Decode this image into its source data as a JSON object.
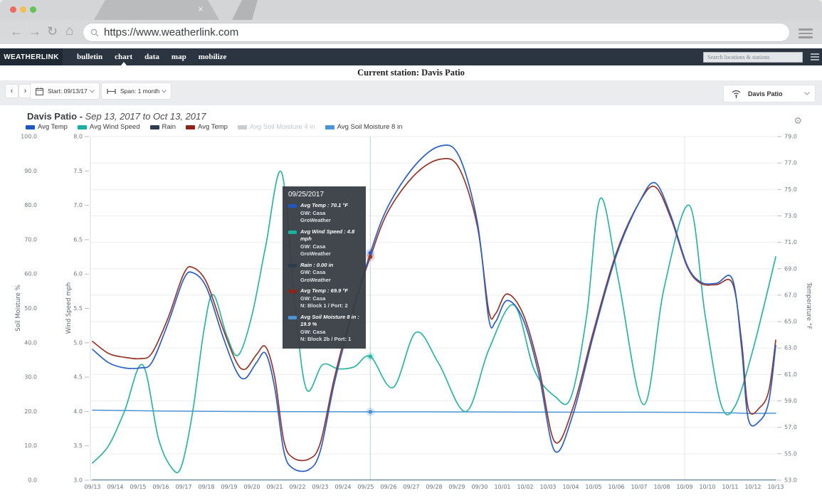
{
  "browser": {
    "url": "https://www.weatherlink.com",
    "tab_close_label": "×"
  },
  "nav": {
    "brand": "WEATHERLINK",
    "items": [
      {
        "label": "bulletin",
        "active": false
      },
      {
        "label": "chart",
        "active": true
      },
      {
        "label": "data",
        "active": false
      },
      {
        "label": "map",
        "active": false
      },
      {
        "label": "mobilize",
        "active": false
      }
    ],
    "search_placeholder": "Search locations & stations"
  },
  "station_bar": {
    "label": "Current station: Davis Patio"
  },
  "controls": {
    "prev": "‹",
    "next": "›",
    "start_label": "Start: 09/13/17",
    "span_label": "Span: 1 month",
    "station_name": "Davis Patio"
  },
  "chart": {
    "title_bold": "Davis Patio - ",
    "title_range": "Sep 13, 2017 to Oct 13, 2017"
  },
  "legend": {
    "items": [
      {
        "label": "Avg Temp",
        "color": "#1f57c0",
        "disabled": false
      },
      {
        "label": "Avg Wind Speed",
        "color": "#18b0a0",
        "disabled": false
      },
      {
        "label": "Rain",
        "color": "#2d3c4e",
        "disabled": false
      },
      {
        "label": "Avg Temp",
        "color": "#8e2318",
        "disabled": false
      },
      {
        "label": "Avg Soil Moisture 4 in",
        "color": "#c7cdd3",
        "disabled": true
      },
      {
        "label": "Avg Soil Moisture 8 in",
        "color": "#4a93d4",
        "disabled": false
      }
    ]
  },
  "tooltip": {
    "date": "09/25/2017",
    "entries": [
      {
        "color": "#1f57c0",
        "value_line": "Avg Temp : 70.1 °F",
        "gw_line": "GW: Casa",
        "src_line": "GroWeather"
      },
      {
        "color": "#18b0a0",
        "value_line": "Avg Wind Speed : 4.8 mph",
        "gw_line": "GW: Casa",
        "src_line": "GroWeather"
      },
      {
        "color": "#2d3c4e",
        "value_line": "Rain : 0.00 in",
        "gw_line": "GW: Casa",
        "src_line": "GroWeather"
      },
      {
        "color": "#8e2318",
        "value_line": "Avg Temp : 69.9 °F",
        "gw_line": "GW: Casa",
        "src_line": "N: Block 1 / Port: 2"
      },
      {
        "color": "#4a93d4",
        "value_line": "Avg Soil Moisture 8 in : 19.9 %",
        "gw_line": "GW: Casa",
        "src_line": "N: Block 2b / Port: 1"
      }
    ]
  },
  "chart_data": {
    "type": "line",
    "title": "Davis Patio - Sep 13, 2017 to Oct 13, 2017",
    "x_labels": [
      "09/13",
      "09/14",
      "09/15",
      "09/16",
      "09/17",
      "09/18",
      "09/19",
      "09/20",
      "09/21",
      "09/22",
      "09/23",
      "09/24",
      "09/25",
      "09/26",
      "09/27",
      "09/28",
      "09/29",
      "09/30",
      "10/01",
      "10/02",
      "10/03",
      "10/04",
      "10/05",
      "10/06",
      "10/07",
      "10/08",
      "10/09",
      "10/10",
      "10/11",
      "10/12",
      "10/13"
    ],
    "axes": {
      "soil": {
        "title": "Soil Moisture %",
        "min": 0,
        "max": 100,
        "ticks": [
          "100.0",
          "90.0",
          "80.0",
          "70.0",
          "60.0",
          "50.0",
          "40.0",
          "30.0",
          "20.0",
          "10.0",
          "0.0"
        ]
      },
      "wind": {
        "title": "Wind Speed mph",
        "min": 3,
        "max": 8,
        "ticks": [
          "8.0",
          "7.5",
          "7.0",
          "6.5",
          "6.0",
          "5.5",
          "5.0",
          "4.5",
          "4.0",
          "3.5",
          "3.0"
        ]
      },
      "temp": {
        "title": "Temperature °F",
        "min": 53,
        "max": 79,
        "ticks": [
          "79.0",
          "77.0",
          "75.0",
          "73.0",
          "71.0",
          "69.0",
          "67.0",
          "65.0",
          "63.0",
          "61.0",
          "59.0",
          "57.0",
          "55.0",
          "53.0"
        ]
      }
    },
    "crosshair": {
      "day": 12.2,
      "date": "09/25/2017"
    },
    "highlight_vline_day": 26,
    "series": [
      {
        "name": "Avg Temp",
        "unit": "°F",
        "axis": "temp",
        "color": "#2b5fc4",
        "width": 1.7,
        "points": [
          [
            0,
            62.9
          ],
          [
            0.7,
            61.9
          ],
          [
            1.4,
            61.5
          ],
          [
            2.1,
            61.5
          ],
          [
            2.6,
            61.9
          ],
          [
            3.3,
            64.8
          ],
          [
            4.0,
            68.2
          ],
          [
            4.4,
            68.7
          ],
          [
            5.0,
            67.6
          ],
          [
            5.7,
            64.0
          ],
          [
            6.3,
            61.3
          ],
          [
            6.7,
            60.7
          ],
          [
            7.2,
            61.9
          ],
          [
            7.6,
            62.6
          ],
          [
            8.0,
            60.0
          ],
          [
            8.4,
            55.2
          ],
          [
            8.8,
            53.9
          ],
          [
            9.5,
            53.8
          ],
          [
            10.0,
            55.2
          ],
          [
            10.6,
            60.2
          ],
          [
            11.3,
            64.9
          ],
          [
            12.2,
            70.2
          ],
          [
            13.0,
            73.8
          ],
          [
            14.2,
            76.9
          ],
          [
            15.3,
            78.3
          ],
          [
            16.1,
            77.5
          ],
          [
            16.9,
            72.5
          ],
          [
            17.4,
            65.2
          ],
          [
            17.7,
            65.0
          ],
          [
            18.2,
            66.6
          ],
          [
            18.9,
            65.2
          ],
          [
            19.6,
            61.0
          ],
          [
            20.3,
            55.2
          ],
          [
            21.1,
            58.0
          ],
          [
            22.0,
            64.0
          ],
          [
            23.0,
            70.0
          ],
          [
            24.0,
            74.0
          ],
          [
            24.7,
            75.5
          ],
          [
            25.4,
            73.0
          ],
          [
            26.1,
            69.3
          ],
          [
            26.7,
            68.0
          ],
          [
            27.4,
            67.9
          ],
          [
            28.1,
            68.2
          ],
          [
            28.5,
            63.0
          ],
          [
            28.8,
            57.6
          ],
          [
            29.3,
            57.5
          ],
          [
            29.7,
            59.0
          ],
          [
            30,
            63.2
          ]
        ]
      },
      {
        "name": "Avg Wind Speed",
        "unit": "mph",
        "axis": "wind",
        "color": "#2bb4a2",
        "width": 1.7,
        "points": [
          [
            0,
            3.25
          ],
          [
            0.7,
            3.5
          ],
          [
            1.4,
            4.0
          ],
          [
            2.2,
            4.68
          ],
          [
            2.9,
            3.6
          ],
          [
            3.5,
            3.17
          ],
          [
            3.9,
            3.2
          ],
          [
            4.4,
            4.0
          ],
          [
            4.9,
            5.2
          ],
          [
            5.3,
            5.7
          ],
          [
            5.9,
            5.1
          ],
          [
            6.4,
            4.82
          ],
          [
            7.0,
            5.4
          ],
          [
            7.6,
            6.4
          ],
          [
            8.3,
            7.48
          ],
          [
            8.9,
            5.5
          ],
          [
            9.4,
            4.32
          ],
          [
            10.1,
            4.68
          ],
          [
            10.8,
            4.62
          ],
          [
            11.5,
            4.65
          ],
          [
            12.2,
            4.8
          ],
          [
            13.2,
            4.35
          ],
          [
            14.2,
            5.15
          ],
          [
            15.2,
            4.7
          ],
          [
            16.4,
            4.0
          ],
          [
            17.4,
            4.9
          ],
          [
            18.5,
            5.55
          ],
          [
            19.4,
            4.6
          ],
          [
            20.3,
            4.22
          ],
          [
            21.0,
            4.2
          ],
          [
            21.7,
            5.4
          ],
          [
            22.3,
            7.1
          ],
          [
            23.1,
            5.9
          ],
          [
            24.2,
            4.1
          ],
          [
            25.1,
            5.8
          ],
          [
            26.2,
            7.0
          ],
          [
            26.9,
            5.4
          ],
          [
            27.6,
            4.1
          ],
          [
            28.2,
            4.07
          ],
          [
            29.0,
            4.9
          ],
          [
            30,
            6.25
          ]
        ]
      },
      {
        "name": "Rain",
        "unit": "in",
        "axis": "soil",
        "color": "#2d3c4e",
        "width": 1.2,
        "points": [
          [
            0,
            0.1
          ],
          [
            10,
            0.1
          ],
          [
            20,
            0.1
          ],
          [
            30,
            0.1
          ]
        ]
      },
      {
        "name": "Avg Temp",
        "unit": "°F",
        "axis": "temp",
        "color": "#96362a",
        "width": 1.7,
        "points": [
          [
            0,
            63.5
          ],
          [
            0.7,
            62.6
          ],
          [
            1.4,
            62.3
          ],
          [
            2.1,
            62.2
          ],
          [
            2.6,
            62.6
          ],
          [
            3.3,
            65.2
          ],
          [
            4.0,
            68.6
          ],
          [
            4.4,
            69.1
          ],
          [
            5.0,
            68.0
          ],
          [
            5.7,
            64.6
          ],
          [
            6.3,
            62.0
          ],
          [
            6.7,
            61.4
          ],
          [
            7.2,
            62.5
          ],
          [
            7.6,
            63.1
          ],
          [
            8.0,
            60.8
          ],
          [
            8.4,
            56.0
          ],
          [
            8.8,
            54.7
          ],
          [
            9.5,
            54.6
          ],
          [
            10.0,
            55.8
          ],
          [
            10.6,
            60.6
          ],
          [
            11.3,
            65.2
          ],
          [
            12.2,
            69.9
          ],
          [
            13.0,
            73.4
          ],
          [
            14.2,
            76.2
          ],
          [
            15.3,
            77.3
          ],
          [
            16.1,
            76.6
          ],
          [
            16.9,
            72.2
          ],
          [
            17.4,
            65.8
          ],
          [
            17.7,
            65.6
          ],
          [
            18.2,
            67.1
          ],
          [
            18.9,
            65.6
          ],
          [
            19.6,
            61.5
          ],
          [
            20.3,
            55.9
          ],
          [
            21.1,
            58.5
          ],
          [
            22.0,
            64.3
          ],
          [
            23.0,
            70.2
          ],
          [
            24.0,
            74.0
          ],
          [
            24.7,
            75.2
          ],
          [
            25.4,
            72.8
          ],
          [
            26.1,
            69.2
          ],
          [
            26.7,
            67.9
          ],
          [
            27.4,
            67.8
          ],
          [
            28.1,
            67.9
          ],
          [
            28.5,
            63.5
          ],
          [
            28.8,
            58.4
          ],
          [
            29.3,
            58.5
          ],
          [
            29.7,
            59.8
          ],
          [
            30,
            63.6
          ]
        ]
      },
      {
        "name": "Avg Soil Moisture 8 in",
        "unit": "%",
        "axis": "soil",
        "color": "#4a93d4",
        "width": 1.5,
        "points": [
          [
            0,
            20.4
          ],
          [
            3,
            20.15
          ],
          [
            6,
            20.0
          ],
          [
            9,
            19.95
          ],
          [
            12.2,
            19.9
          ],
          [
            15,
            19.9
          ],
          [
            18,
            19.85
          ],
          [
            21,
            19.8
          ],
          [
            24,
            19.8
          ],
          [
            26.5,
            19.75
          ],
          [
            28,
            19.6
          ],
          [
            29,
            19.45
          ],
          [
            30,
            19.5
          ]
        ]
      }
    ],
    "markers": [
      {
        "day": 12.2,
        "axis": "temp",
        "value": 70.2,
        "color": "#2b5fc4"
      },
      {
        "day": 12.2,
        "axis": "temp",
        "value": 69.9,
        "color": "#96362a"
      },
      {
        "day": 12.2,
        "axis": "wind",
        "value": 4.8,
        "color": "#2bb4a2"
      },
      {
        "day": 12.2,
        "axis": "soil",
        "value": 19.9,
        "color": "#4a93d4"
      }
    ]
  }
}
